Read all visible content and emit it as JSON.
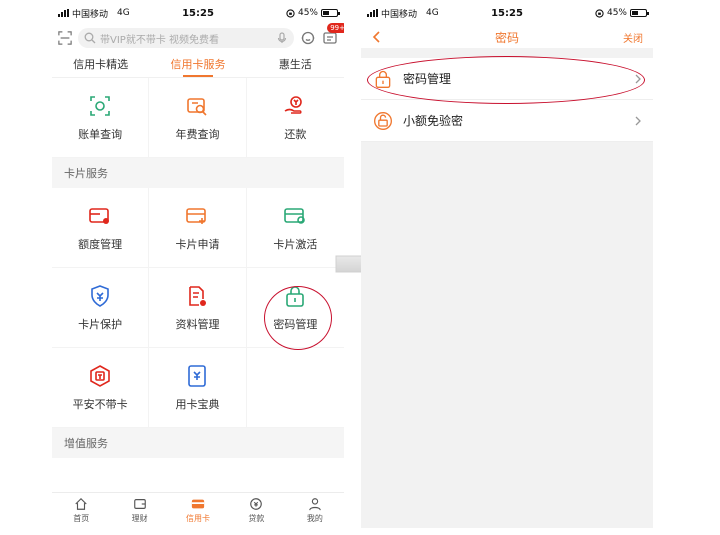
{
  "left": {
    "status": {
      "carrier": "中国移动",
      "network": "4G",
      "time": "15:25",
      "battery": "45%"
    },
    "search": {
      "placeholder": "带VIP就不带卡 视频免费看",
      "badge": "99+"
    },
    "tabs": [
      {
        "label": "信用卡精选"
      },
      {
        "label": "信用卡服务"
      },
      {
        "label": "惠生活"
      }
    ],
    "top_grid": [
      {
        "label": "账单查询"
      },
      {
        "label": "年费查询"
      },
      {
        "label": "还款"
      }
    ],
    "section1": "卡片服务",
    "card_grid": [
      {
        "label": "额度管理"
      },
      {
        "label": "卡片申请"
      },
      {
        "label": "卡片激活"
      },
      {
        "label": "卡片保护"
      },
      {
        "label": "资料管理"
      },
      {
        "label": "密码管理"
      },
      {
        "label": "平安不带卡"
      },
      {
        "label": "用卡宝典"
      }
    ],
    "section2": "增值服务",
    "tabbar": [
      {
        "label": "首页"
      },
      {
        "label": "理财"
      },
      {
        "label": "信用卡"
      },
      {
        "label": "贷款"
      },
      {
        "label": "我的"
      }
    ]
  },
  "right": {
    "status": {
      "carrier": "中国移动",
      "network": "4G",
      "time": "15:25",
      "battery": "45%"
    },
    "nav": {
      "title": "密码",
      "close": "关闭"
    },
    "items": [
      {
        "label": "密码管理"
      },
      {
        "label": "小额免验密"
      }
    ]
  },
  "colors": {
    "accent": "#f0772f",
    "green": "#2aa876",
    "blue": "#2f6bd6",
    "red_mark": "#c8102e"
  }
}
